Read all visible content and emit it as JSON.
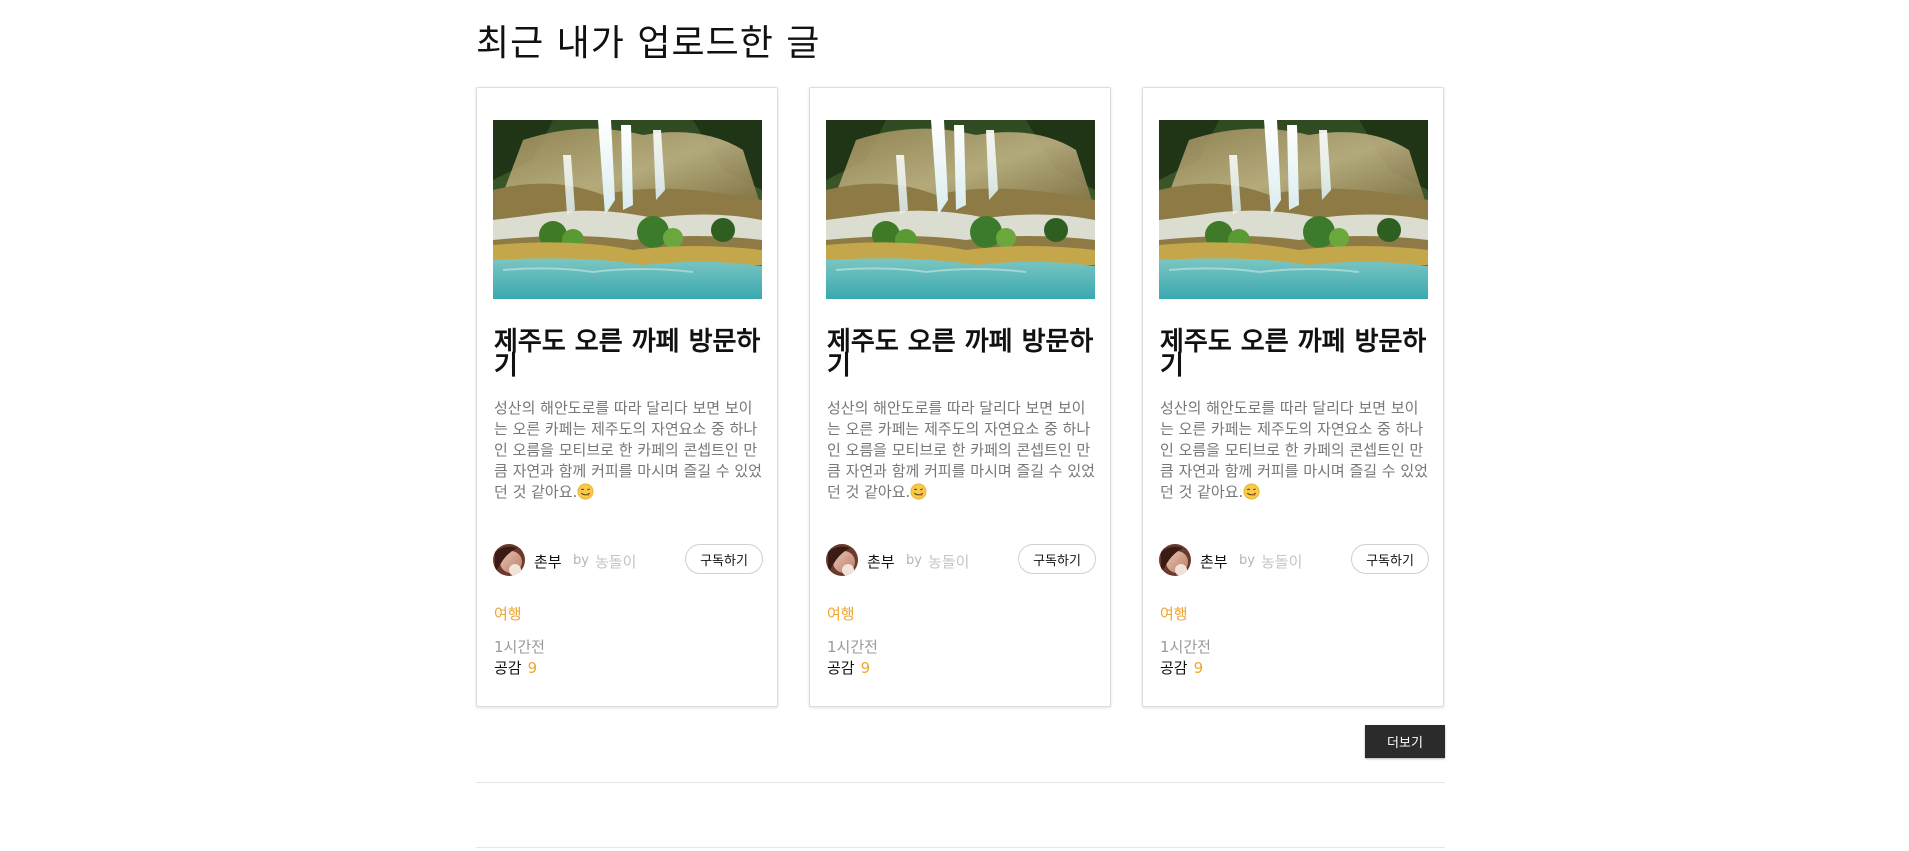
{
  "section": {
    "title": "최근 내가 업로드한 글",
    "more_label": "더보기"
  },
  "cards": [
    {
      "image_icon": "waterfall-photo",
      "title": "제주도 오른 까페 방문하기",
      "desc": "성산의 해안도로를 따라 달리다 보면 보이는 오른 카페는 제주도의 자연요소 중 하나인 오름을 모티브로 한 카페의 콘셉트인 만큼 자연과 함께 커피를 마시며 즐길 수 있었던 것 같아요.",
      "emoji": "yum-face-emoji",
      "author": "촌부",
      "by": "by",
      "sub_author": "농돌이",
      "subscribe_label": "구독하기",
      "category": "여행",
      "time": "1시간전",
      "likes_label": "공감",
      "likes_count": "9"
    },
    {
      "image_icon": "waterfall-photo",
      "title": "제주도 오른 까페 방문하기",
      "desc": "성산의 해안도로를 따라 달리다 보면 보이는 오른 카페는 제주도의 자연요소 중 하나인 오름을 모티브로 한 카페의 콘셉트인 만큼 자연과 함께 커피를 마시며 즐길 수 있었던 것 같아요.",
      "emoji": "yum-face-emoji",
      "author": "촌부",
      "by": "by",
      "sub_author": "농돌이",
      "subscribe_label": "구독하기",
      "category": "여행",
      "time": "1시간전",
      "likes_label": "공감",
      "likes_count": "9"
    },
    {
      "image_icon": "waterfall-photo",
      "title": "제주도 오른 까페 방문하기",
      "desc": "성산의 해안도로를 따라 달리다 보면 보이는 오른 카페는 제주도의 자연요소 중 하나인 오름을 모티브로 한 카페의 콘셉트인 만큼 자연과 함께 커피를 마시며 즐길 수 있었던 것 같아요.",
      "emoji": "yum-face-emoji",
      "author": "촌부",
      "by": "by",
      "sub_author": "농돌이",
      "subscribe_label": "구독하기",
      "category": "여행",
      "time": "1시간전",
      "likes_label": "공감",
      "likes_count": "9"
    }
  ],
  "colors": {
    "accent": "#f0a531",
    "more_button_bg": "#2b2b2b",
    "desc_text": "#777777"
  }
}
